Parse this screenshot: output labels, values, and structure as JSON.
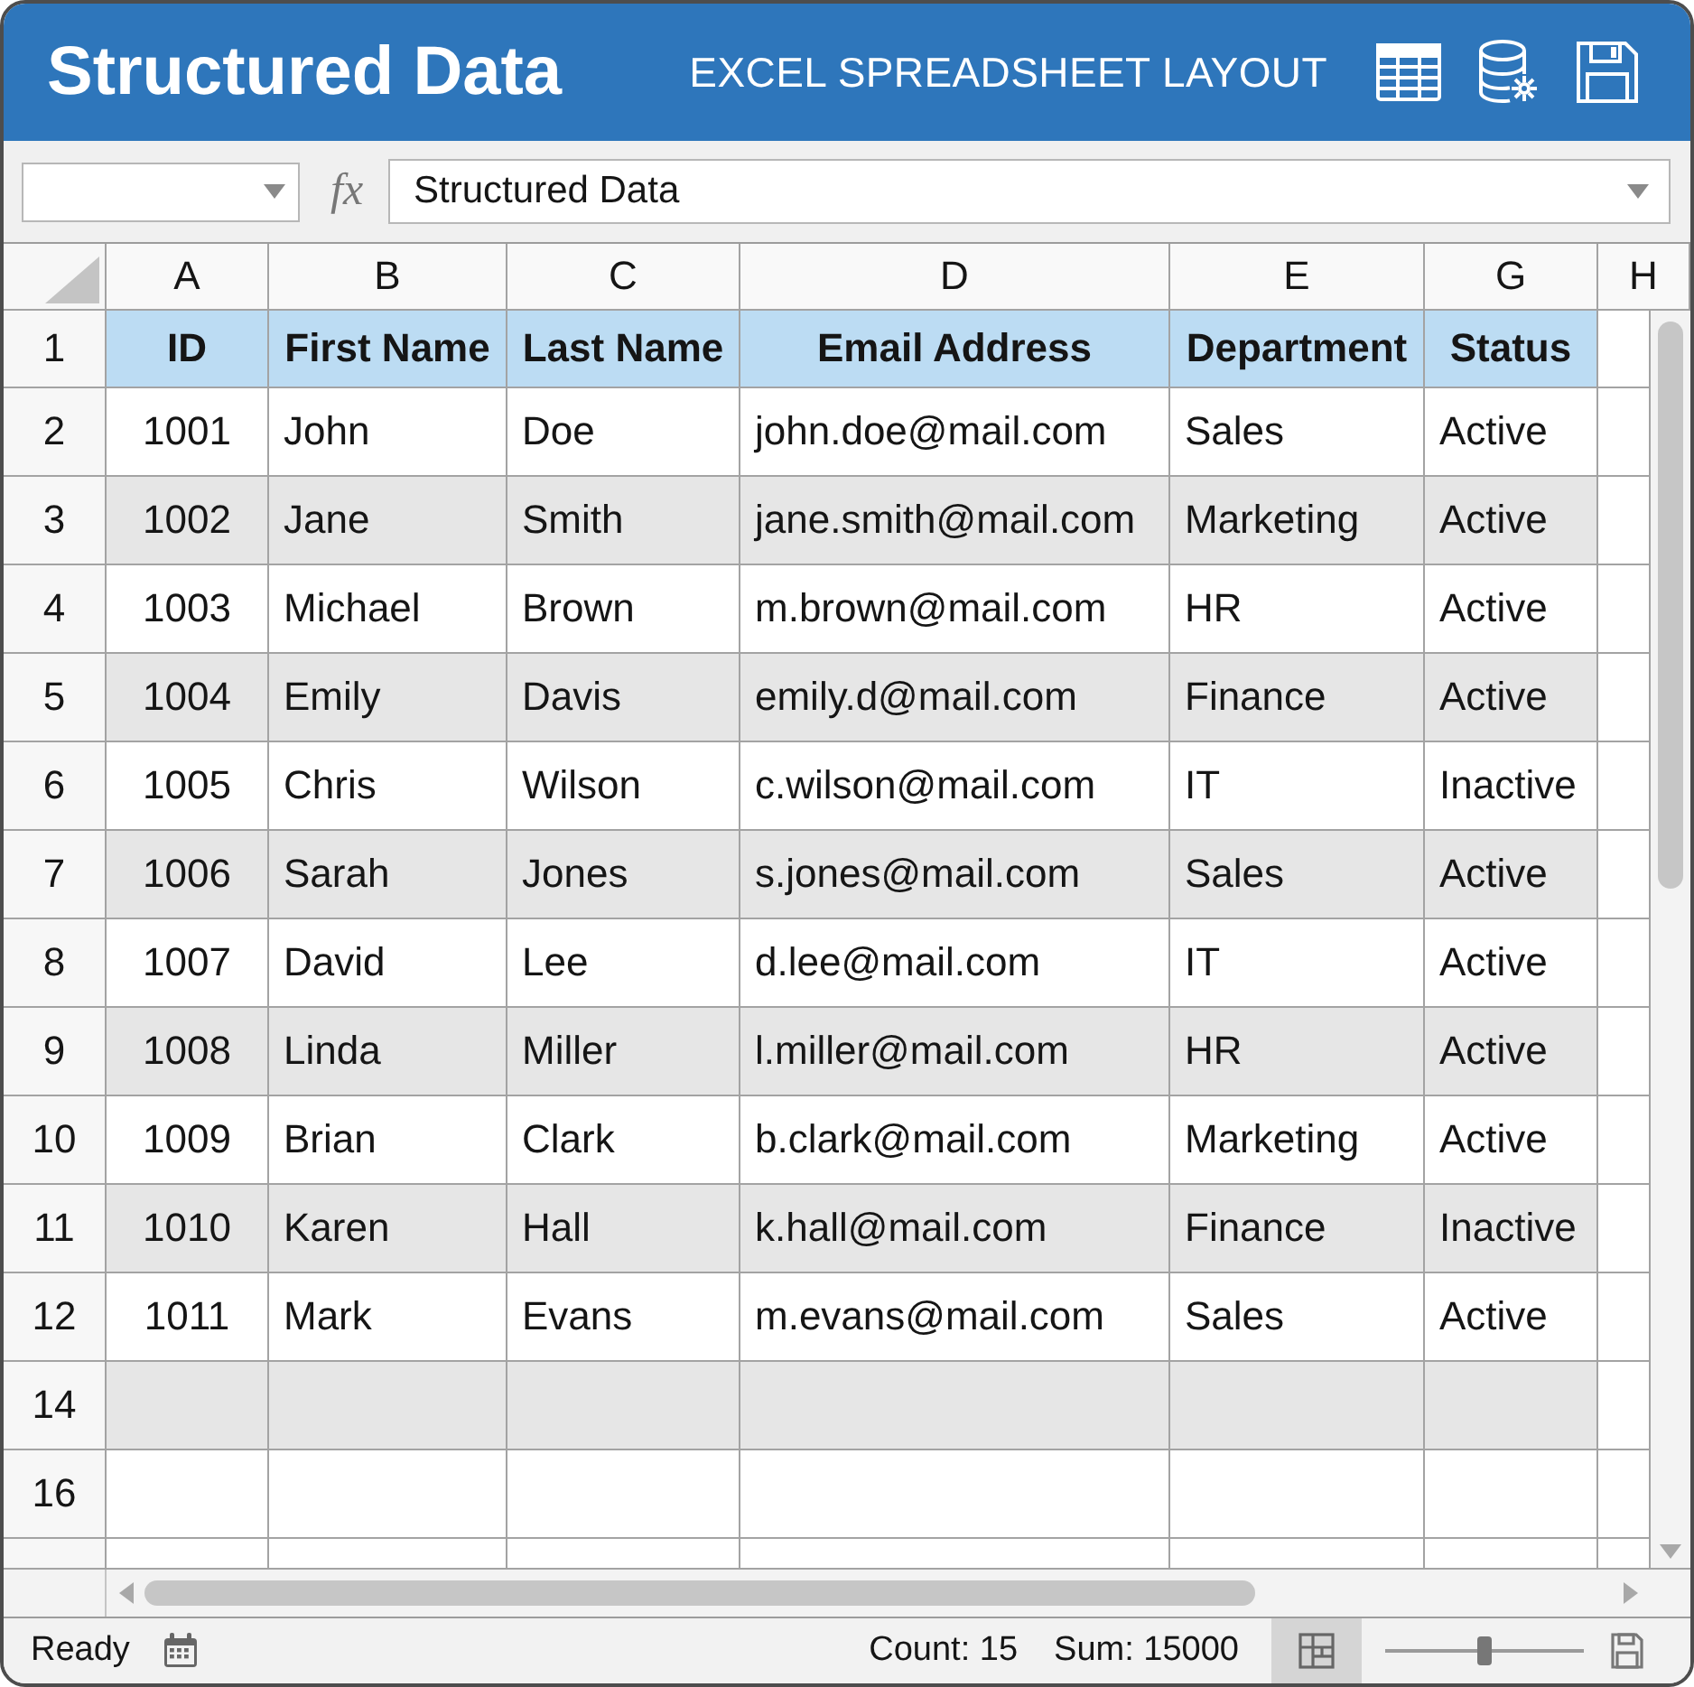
{
  "title_bar": {
    "title": "Structured Data",
    "subtitle": "EXCEL SPREADSHEET LAYOUT"
  },
  "formula_bar": {
    "function_label": "fx",
    "formula": "Structured Data"
  },
  "sheet": {
    "columns": [
      "A",
      "B",
      "C",
      "D",
      "E",
      "G",
      "H"
    ],
    "rows": [
      {
        "number": "1",
        "kind": "header",
        "cells": [
          "ID",
          "First Name",
          "Last Name",
          "Email Address",
          "Department",
          "Status"
        ]
      },
      {
        "number": "2",
        "kind": "data",
        "cells": [
          "1001",
          "John",
          "Doe",
          "john.doe@mail.com",
          "Sales",
          "Active"
        ]
      },
      {
        "number": "3",
        "kind": "data",
        "cells": [
          "1002",
          "Jane",
          "Smith",
          "jane.smith@mail.com",
          "Marketing",
          "Active"
        ]
      },
      {
        "number": "4",
        "kind": "data",
        "cells": [
          "1003",
          "Michael",
          "Brown",
          "m.brown@mail.com",
          "HR",
          "Active"
        ]
      },
      {
        "number": "5",
        "kind": "data",
        "cells": [
          "1004",
          "Emily",
          "Davis",
          "emily.d@mail.com",
          "Finance",
          "Active"
        ]
      },
      {
        "number": "6",
        "kind": "data",
        "cells": [
          "1005",
          "Chris",
          "Wilson",
          "c.wilson@mail.com",
          "IT",
          "Inactive"
        ]
      },
      {
        "number": "7",
        "kind": "data",
        "cells": [
          "1006",
          "Sarah",
          "Jones",
          "s.jones@mail.com",
          "Sales",
          "Active"
        ]
      },
      {
        "number": "8",
        "kind": "data",
        "cells": [
          "1007",
          "David",
          "Lee",
          "d.lee@mail.com",
          "IT",
          "Active"
        ]
      },
      {
        "number": "9",
        "kind": "data",
        "cells": [
          "1008",
          "Linda",
          "Miller",
          "l.miller@mail.com",
          "HR",
          "Active"
        ]
      },
      {
        "number": "10",
        "kind": "data",
        "cells": [
          "1009",
          "Brian",
          "Clark",
          "b.clark@mail.com",
          "Marketing",
          "Active"
        ]
      },
      {
        "number": "11",
        "kind": "data",
        "cells": [
          "1010",
          "Karen",
          "Hall",
          "k.hall@mail.com",
          "Finance",
          "Inactive"
        ]
      },
      {
        "number": "12",
        "kind": "data",
        "cells": [
          "1011",
          "Mark",
          "Evans",
          "m.evans@mail.com",
          "Sales",
          "Active"
        ]
      },
      {
        "number": "14",
        "kind": "data"
      },
      {
        "number": "16",
        "kind": "data"
      }
    ]
  },
  "status_bar": {
    "status": "Ready",
    "count": "Count: 15",
    "sum": "Sum: 15000",
    "normal_view": {
      "selected": true
    },
    "zoom": {
      "level": 0.5
    }
  }
}
